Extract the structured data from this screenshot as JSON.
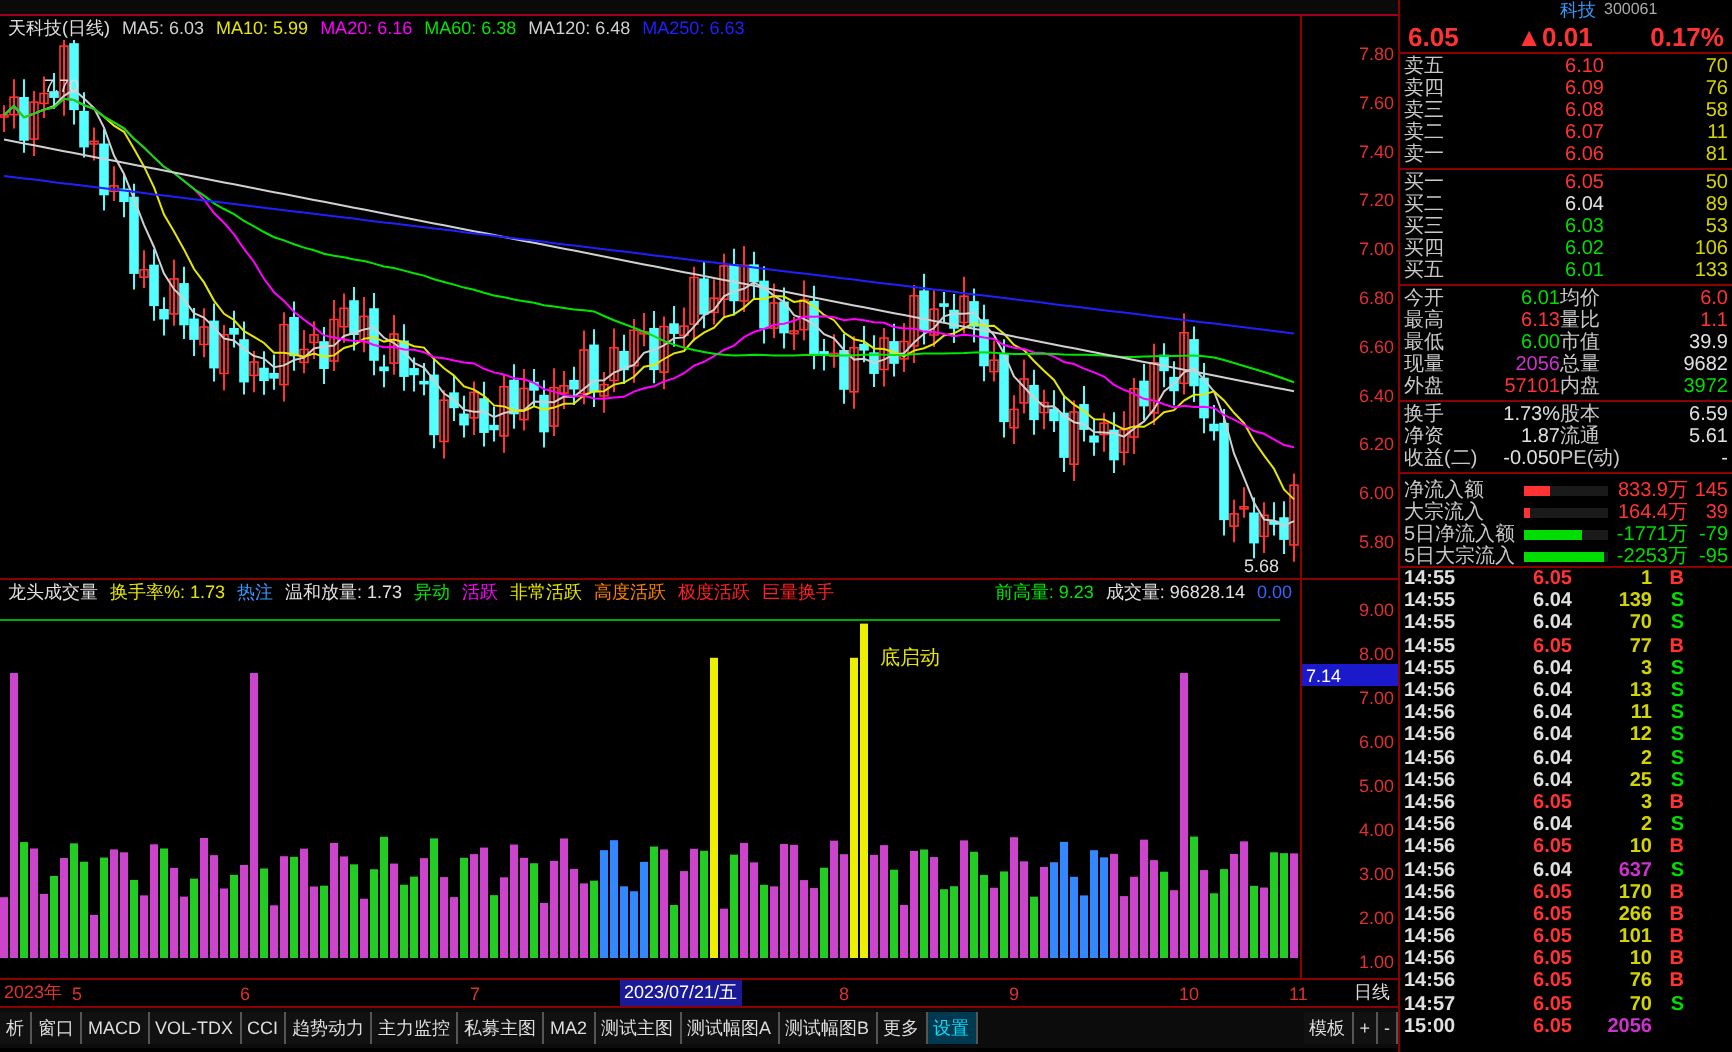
{
  "chart": {
    "title": "天科技(日线)",
    "mas": [
      {
        "label": "MA5: 6.03",
        "color": "#d0d0d0"
      },
      {
        "label": "MA10: 5.99",
        "color": "#e6e600"
      },
      {
        "label": "MA20: 6.16",
        "color": "#ff00ff"
      },
      {
        "label": "MA60: 6.38",
        "color": "#00e600"
      },
      {
        "label": "MA120: 6.48",
        "color": "#d0d0d0"
      },
      {
        "label": "MA250: 6.63",
        "color": "#2020ff"
      }
    ],
    "price_ticks": [
      "7.80",
      "7.60",
      "7.40",
      "7.20",
      "7.00",
      "6.80",
      "6.60",
      "6.40",
      "6.20",
      "6.00",
      "5.80"
    ],
    "high_label": "7.70",
    "low_label": "5.68"
  },
  "indicator": {
    "title": "龙头成交量",
    "items": [
      {
        "label": "换手率%: 1.73",
        "color": "#e6e600"
      },
      {
        "label": "热注",
        "color": "#3399ff"
      },
      {
        "label": "温和放量: 1.73",
        "color": "#e0e0e0"
      },
      {
        "label": "异动",
        "color": "#00e600"
      },
      {
        "label": "活跃",
        "color": "#ff00ff"
      },
      {
        "label": "非常活跃",
        "color": "#e6e600"
      },
      {
        "label": "高度活跃",
        "color": "#ff8000"
      },
      {
        "label": "极度活跃",
        "color": "#ff2020"
      },
      {
        "label": "巨量换手",
        "color": "#ff2020"
      }
    ],
    "right_items": [
      {
        "label": "前高量: 9.23",
        "color": "#00e600"
      },
      {
        "label": "成交量: 96828.14",
        "color": "#e0e0e0"
      },
      {
        "label": "0.00",
        "color": "#3366ff"
      }
    ],
    "ticks": [
      "9.00",
      "8.00",
      "7.00",
      "6.00",
      "5.00",
      "4.00",
      "3.00",
      "2.00",
      "1.00"
    ],
    "marker": "7.14",
    "annotation": "底启动"
  },
  "dates": {
    "labels": [
      "2023年",
      "5",
      "6",
      "7",
      "8",
      "9",
      "10",
      "11"
    ],
    "current": "2023/07/21/五",
    "period": "日线"
  },
  "tabs": [
    {
      "label": "析",
      "selected": false
    },
    {
      "label": "窗口",
      "selected": false
    },
    {
      "label": "MACD",
      "selected": false
    },
    {
      "label": "VOL-TDX",
      "selected": false
    },
    {
      "label": "CCI",
      "selected": false
    },
    {
      "label": "趋势动力",
      "selected": false
    },
    {
      "label": "主力监控",
      "selected": false
    },
    {
      "label": "私募主图",
      "selected": false
    },
    {
      "label": "MA2",
      "selected": false
    },
    {
      "label": "测试主图",
      "selected": false
    },
    {
      "label": "测试幅图A",
      "selected": false
    },
    {
      "label": "测试幅图B",
      "selected": false
    },
    {
      "label": "更多",
      "selected": false
    },
    {
      "label": "设置",
      "selected": true
    }
  ],
  "tab_tools": [
    "模板",
    "+",
    "-"
  ],
  "quote": {
    "name": "科技",
    "code": "300061",
    "price": "6.05",
    "change": "▲0.01",
    "percent": "0.17%"
  },
  "asks": [
    {
      "label": "卖五",
      "price": "6.10",
      "volume": "70",
      "color": "#ff3333"
    },
    {
      "label": "卖四",
      "price": "6.09",
      "volume": "76",
      "color": "#ff3333"
    },
    {
      "label": "卖三",
      "price": "6.08",
      "volume": "58",
      "color": "#ff3333"
    },
    {
      "label": "卖二",
      "price": "6.07",
      "volume": "11",
      "color": "#ff3333"
    },
    {
      "label": "卖一",
      "price": "6.06",
      "volume": "81",
      "color": "#ff3333"
    }
  ],
  "bids": [
    {
      "label": "买一",
      "price": "6.05",
      "volume": "50",
      "color": "#ff3333"
    },
    {
      "label": "买二",
      "price": "6.04",
      "volume": "89",
      "color": "#e0e0e0"
    },
    {
      "label": "买三",
      "price": "6.03",
      "volume": "53",
      "color": "#00dd00"
    },
    {
      "label": "买四",
      "price": "6.02",
      "volume": "106",
      "color": "#00dd00"
    },
    {
      "label": "买五",
      "price": "6.01",
      "volume": "133",
      "color": "#00dd00"
    }
  ],
  "stats": [
    {
      "label": "今开",
      "value": "6.01",
      "color": "#00dd00"
    },
    {
      "label": "均价",
      "value": "6.0",
      "color": "#ff3333"
    },
    {
      "label": "最高",
      "value": "6.13",
      "color": "#ff3333"
    },
    {
      "label": "量比",
      "value": "1.1",
      "color": "#ff3333"
    },
    {
      "label": "最低",
      "value": "6.00",
      "color": "#00dd00"
    },
    {
      "label": "市值",
      "value": "39.9",
      "color": "#e0e0e0"
    },
    {
      "label": "现量",
      "value": "2056",
      "color": "#cc33cc"
    },
    {
      "label": "总量",
      "value": "9682",
      "color": "#e0e0e0"
    },
    {
      "label": "外盘",
      "value": "57101",
      "color": "#ff3333"
    },
    {
      "label": "内盘",
      "value": "3972",
      "color": "#00dd00"
    }
  ],
  "stats2": [
    {
      "label": "换手",
      "value": "1.73%"
    },
    {
      "label": "股本",
      "value": "6.59"
    },
    {
      "label": "净资",
      "value": "1.87"
    },
    {
      "label": "流通",
      "value": "5.61"
    },
    {
      "label": "收益(二)",
      "value": "-0.050"
    },
    {
      "label": "PE(动)",
      "value": "-"
    }
  ],
  "flows": [
    {
      "label": "净流入额",
      "level": 0.3,
      "color": "#ff3333",
      "value": "833.9万",
      "extra": "145"
    },
    {
      "label": "大宗流入",
      "level": 0.06,
      "color": "#ff3333",
      "value": "164.4万",
      "extra": "39"
    },
    {
      "label": "5日净流入额",
      "level": 0.7,
      "color": "#00dd00",
      "value": "-1771万",
      "extra": "-79"
    },
    {
      "label": "5日大宗流入",
      "level": 0.95,
      "color": "#00dd00",
      "value": "-2253万",
      "extra": "-95"
    }
  ],
  "trades": [
    {
      "time": "14:55",
      "price": "6.05",
      "color": "#ff3333",
      "volume": "1",
      "big": false,
      "side": "B",
      "buy": true
    },
    {
      "time": "14:55",
      "price": "6.04",
      "color": "#e0e0e0",
      "volume": "139",
      "big": false,
      "side": "S",
      "buy": false
    },
    {
      "time": "14:55",
      "price": "6.04",
      "color": "#e0e0e0",
      "volume": "70",
      "big": false,
      "side": "S",
      "buy": false
    },
    {
      "time": "14:55",
      "price": "6.05",
      "color": "#ff3333",
      "volume": "77",
      "big": false,
      "side": "B",
      "buy": true
    },
    {
      "time": "14:55",
      "price": "6.04",
      "color": "#e0e0e0",
      "volume": "3",
      "big": false,
      "side": "S",
      "buy": false
    },
    {
      "time": "14:56",
      "price": "6.04",
      "color": "#e0e0e0",
      "volume": "13",
      "big": false,
      "side": "S",
      "buy": false
    },
    {
      "time": "14:56",
      "price": "6.04",
      "color": "#e0e0e0",
      "volume": "11",
      "big": false,
      "side": "S",
      "buy": false
    },
    {
      "time": "14:56",
      "price": "6.04",
      "color": "#e0e0e0",
      "volume": "12",
      "big": false,
      "side": "S",
      "buy": false
    },
    {
      "time": "14:56",
      "price": "6.04",
      "color": "#e0e0e0",
      "volume": "2",
      "big": false,
      "side": "S",
      "buy": false
    },
    {
      "time": "14:56",
      "price": "6.04",
      "color": "#e0e0e0",
      "volume": "25",
      "big": false,
      "side": "S",
      "buy": false
    },
    {
      "time": "14:56",
      "price": "6.05",
      "color": "#ff3333",
      "volume": "3",
      "big": false,
      "side": "B",
      "buy": true
    },
    {
      "time": "14:56",
      "price": "6.04",
      "color": "#e0e0e0",
      "volume": "2",
      "big": false,
      "side": "S",
      "buy": false
    },
    {
      "time": "14:56",
      "price": "6.05",
      "color": "#ff3333",
      "volume": "10",
      "big": false,
      "side": "B",
      "buy": true
    },
    {
      "time": "14:56",
      "price": "6.04",
      "color": "#e0e0e0",
      "volume": "637",
      "big": true,
      "side": "S",
      "buy": false
    },
    {
      "time": "14:56",
      "price": "6.05",
      "color": "#ff3333",
      "volume": "170",
      "big": false,
      "side": "B",
      "buy": true
    },
    {
      "time": "14:56",
      "price": "6.05",
      "color": "#ff3333",
      "volume": "266",
      "big": false,
      "side": "B",
      "buy": true
    },
    {
      "time": "14:56",
      "price": "6.05",
      "color": "#ff3333",
      "volume": "101",
      "big": false,
      "side": "B",
      "buy": true
    },
    {
      "time": "14:56",
      "price": "6.05",
      "color": "#ff3333",
      "volume": "10",
      "big": false,
      "side": "B",
      "buy": true
    },
    {
      "time": "14:56",
      "price": "6.05",
      "color": "#ff3333",
      "volume": "76",
      "big": false,
      "side": "B",
      "buy": true
    },
    {
      "time": "14:57",
      "price": "6.05",
      "color": "#ff3333",
      "volume": "70",
      "big": false,
      "side": "S",
      "buy": false
    },
    {
      "time": "15:00",
      "price": "6.05",
      "color": "#ff3333",
      "volume": "2056",
      "big": true
    }
  ]
}
